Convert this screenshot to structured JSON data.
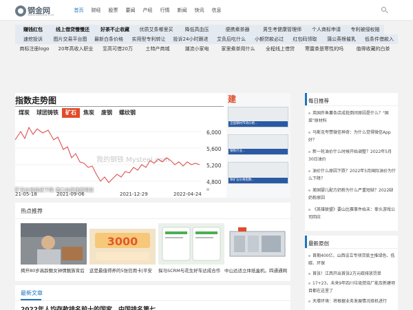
{
  "header": {
    "logo_text": "钢金网",
    "logo_sub": "WWW.GANGJIN.COM",
    "nav": [
      "首页",
      "财经",
      "股票",
      "要闻",
      "产经",
      "行情",
      "新闻",
      "快讯",
      "信息"
    ],
    "active_index": 0
  },
  "links": {
    "row1": [
      "赚钱红包",
      "线上借贷慢慢还",
      "好茶不止收藏",
      "优质艾条哪里买",
      "降低高血压",
      "便携煮茶器",
      "男生考健康管理师",
      "个人商标申请",
      "专利被侵权赔"
    ],
    "row2": [
      "速挖投诉",
      "图片交易平台图",
      "最新白条价格",
      "实用型专利转让",
      "投诉24小时跟进",
      "艾灸后吃什么",
      "小额贷款必过",
      "红包码领取",
      "蒲公英根催乳",
      "低条件借款入"
    ],
    "row3": [
      "商标注册logo",
      "20年高收入职业",
      "至高可借20万",
      "土特产商城",
      "潮流小家电",
      "家里煮茶用什么",
      "全程线上借贷",
      "寒露茶是寒性的吗",
      "值得收藏的白茶"
    ]
  },
  "slider": {
    "chart_title": "指数走势图",
    "tabs": [
      "煤炭",
      "球团铸铁",
      "矿石",
      "焦炭",
      "废钢",
      "螺纹钢"
    ],
    "highlight_tab": 2,
    "watermark": "我的钢铁 Mysteel.com",
    "y_ticks": [
      "6,000",
      "5,600",
      "5,200",
      "4,800"
    ],
    "x_ticks": [
      "21-05-18",
      "2021-09-06",
      "2021-12-29",
      "2022-04-24"
    ],
    "side_title": "建",
    "side_caption_1": "全国钢材市场价格...",
    "side_caption_2": "钢铁行业...",
    "side_caption_3": "铁矿石价格指数...",
    "caption": "矿石价格延续下降 港口去库速度明显"
  },
  "hot": {
    "title": "热点推荐",
    "items": [
      {
        "caption": "揭开80岁高龄魅女钟情魅族背后"
      },
      {
        "caption": "这是最值得养的5张信用卡|平安",
        "banner": "3000"
      },
      {
        "caption": "探马SCRM与花生好车达成合作"
      },
      {
        "caption": "中山达适立体纸盒机，四通通网"
      }
    ]
  },
  "latest": {
    "title": "最新文章",
    "first": "2022年人均存款排名前十的国家，中国排名第七"
  },
  "daily": {
    "title": "每日推荐",
    "items": [
      "英国炸鱼薯条店成批倒闭原因是什么？\"国菜\"原材料",
      "马斯克夸赞微信神奇：为什么觉得微信App好？",
      "新一轮油价什么时候开始调整？2022年5月30日油价",
      "油价什么原因下跌？2022年5月国际油价为什么下降？",
      "美国婴儿配方奶粉为什么严重短缺？2022缺奶粉原因",
      "《英雄联盟》要山比赛事件始末：拳头游戏公司回应"
    ]
  },
  "newest": {
    "title": "最新原创",
    "items": [
      "首期400亿，山西设立专项贷款主推绿色、低碳、环保",
      "首张！江西开出首张2万元碳排放罚单",
      "17+23，未来9年四川垃圾焚烧厂能及新建项目都在这里了",
      "天壕环境：将根据业务发展情况择机进行"
    ]
  }
}
